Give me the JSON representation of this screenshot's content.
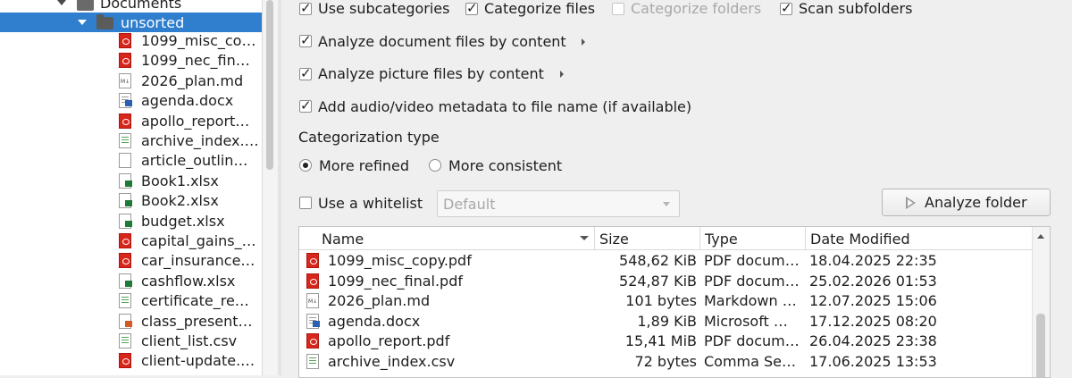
{
  "tree": {
    "parent_label": "Documents",
    "selected_label": "unsorted",
    "files": [
      {
        "name": "1099_misc_co…",
        "type": "pdf"
      },
      {
        "name": "1099_nec_fin…",
        "type": "pdf"
      },
      {
        "name": "2026_plan.md",
        "type": "md"
      },
      {
        "name": "agenda.docx",
        "type": "docx"
      },
      {
        "name": "apollo_report…",
        "type": "pdf"
      },
      {
        "name": "archive_index.…",
        "type": "csv"
      },
      {
        "name": "article_outlin…",
        "type": "txt"
      },
      {
        "name": "Book1.xlsx",
        "type": "xlsx"
      },
      {
        "name": "Book2.xlsx",
        "type": "xlsx"
      },
      {
        "name": "budget.xlsx",
        "type": "xlsx"
      },
      {
        "name": "capital_gains_…",
        "type": "pdf"
      },
      {
        "name": "car_insurance…",
        "type": "pdf"
      },
      {
        "name": "cashflow.xlsx",
        "type": "xlsx"
      },
      {
        "name": "certificate_re…",
        "type": "csv"
      },
      {
        "name": "class_present…",
        "type": "pptx"
      },
      {
        "name": "client_list.csv",
        "type": "csv"
      },
      {
        "name": "client-update.…",
        "type": "pdf"
      }
    ]
  },
  "options": {
    "use_subcategories": {
      "label": "Use subcategories",
      "checked": true
    },
    "categorize_files": {
      "label": "Categorize files",
      "checked": true
    },
    "categorize_folders": {
      "label": "Categorize folders",
      "checked": false,
      "disabled": true
    },
    "scan_subfolders": {
      "label": "Scan subfolders",
      "checked": true
    },
    "analyze_documents": {
      "label": "Analyze document files by content",
      "checked": true
    },
    "analyze_pictures": {
      "label": "Analyze picture files by content",
      "checked": true
    },
    "audio_video_metadata": {
      "label": "Add audio/video metadata to file name (if available)",
      "checked": true
    },
    "categorization_type_label": "Categorization type",
    "radio_refined": {
      "label": "More refined",
      "checked": true
    },
    "radio_consistent": {
      "label": "More consistent",
      "checked": false
    },
    "whitelist": {
      "label": "Use a whitelist",
      "checked": false
    },
    "whitelist_value": "Default",
    "analyze_button": "Analyze folder"
  },
  "table": {
    "columns": [
      "Name",
      "Size",
      "Type",
      "Date Modified"
    ],
    "rows": [
      {
        "name": "1099_misc_copy.pdf",
        "size": "548,62 KiB",
        "type": "PDF docum…",
        "date": "18.04.2025 22:35",
        "icon": "pdf"
      },
      {
        "name": "1099_nec_final.pdf",
        "size": "524,87 KiB",
        "type": "PDF docum…",
        "date": "25.02.2026 01:53",
        "icon": "pdf"
      },
      {
        "name": "2026_plan.md",
        "size": "101 bytes",
        "type": "Markdown …",
        "date": "12.07.2025 15:06",
        "icon": "md"
      },
      {
        "name": "agenda.docx",
        "size": "1,89 KiB",
        "type": "Microsoft …",
        "date": "17.12.2025 08:20",
        "icon": "docx"
      },
      {
        "name": "apollo_report.pdf",
        "size": "15,41 MiB",
        "type": "PDF docum…",
        "date": "26.04.2025 23:38",
        "icon": "pdf"
      },
      {
        "name": "archive_index.csv",
        "size": "72 bytes",
        "type": "Comma Se…",
        "date": "17.06.2025 13:53",
        "icon": "csv"
      }
    ]
  },
  "colors": {
    "selection": "#2f7fce",
    "window_bg": "#efefef",
    "pdf_red": "#d7261b",
    "xlsx_green": "#1f7a3a",
    "folder_grey": "#6a6a6a"
  }
}
